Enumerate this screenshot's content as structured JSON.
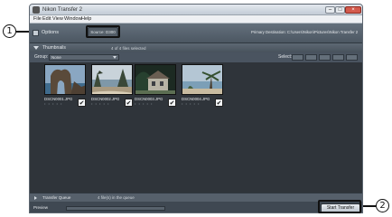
{
  "callouts": [
    "1",
    "2"
  ],
  "window": {
    "title": "Nikon Transfer 2",
    "controls": {
      "minimize": "–",
      "maximize": "□",
      "close": "×"
    }
  },
  "menu": {
    "items": [
      "File",
      "Edit",
      "View",
      "Window",
      "Help"
    ]
  },
  "options_bar": {
    "options_label": "Options",
    "source": "Source: D300",
    "destination": "Primary Destination: C:\\Users\\Nikon\\Pictures\\Nikon Transfer 2"
  },
  "thumbnails": {
    "label": "Thumbnails",
    "count": "4 of 4 files selected",
    "group_label": "Group:",
    "group_value": "None",
    "select_label": "Select:",
    "items": [
      {
        "name": "DSCN0001.JPG",
        "checked": "✔",
        "rating": "• • • • •"
      },
      {
        "name": "DSCN0002.JPG",
        "checked": "✔",
        "rating": "• • • • •"
      },
      {
        "name": "DSCN0003.JPG",
        "checked": "✔",
        "rating": "• • • • •"
      },
      {
        "name": "DSCN0004.JPG",
        "checked": "✔",
        "rating": "• • • • •"
      }
    ]
  },
  "queue": {
    "label": "Transfer Queue",
    "count": "4 file(s) in the queue"
  },
  "status": {
    "preview_label": "Preview",
    "start_button": "Start Transfer"
  },
  "colors": {
    "accent": "#4c5762",
    "gallery_bg": "#2f343a"
  }
}
